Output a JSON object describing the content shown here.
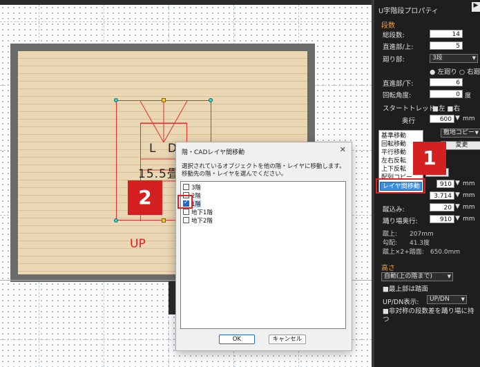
{
  "panel": {
    "title": "U字階段プロパティ",
    "section_steps": "段数",
    "total_steps_label": "総段数:",
    "total_steps_value": "14",
    "straight_upper_label": "直進部/上:",
    "straight_upper_value": "5",
    "turn_label": "廻り部:",
    "turn_value": "3段",
    "turn_dir_left": "左廻り",
    "turn_dir_right": "右廻り",
    "straight_lower_label": "直進部/下:",
    "straight_lower_value": "6",
    "rotation_label": "回転角度:",
    "rotation_value": "0",
    "rotation_unit": "度",
    "start_tread_label": "スタートトレッド",
    "start_left": "左",
    "start_right": "右",
    "depth_label": "奥行",
    "depth_value": "600",
    "depth_unit": "mm",
    "right_drop_label": "敷地コピー",
    "change_label": "変更",
    "width_value": "910",
    "width_unit": "mm",
    "rise_value": "3.714",
    "rise_unit": "mm",
    "nosing_label": "蹴込み:",
    "nosing_value": "20",
    "nosing_unit": "mm",
    "landing_label": "踊り場奥行:",
    "landing_value": "910",
    "landing_unit": "mm",
    "rise_ro": "蹴上:　　207mm",
    "slope_ro": "勾配:　　41.3度",
    "calc_ro": "蹴上×2+踏面:　650.0mm",
    "section_height": "高さ",
    "height_mode": "自動(上の階まで)",
    "top_floor_label": "最上部は踏面",
    "updn_label": "UP/DN表示:",
    "updn_value": "UP/DN",
    "nonsym_label": "非対称の段数差を踊り場に持つ"
  },
  "context_menu": {
    "items": [
      "基準移動",
      "回転移動",
      "平行移動",
      "左右反転",
      "上下反転",
      "配列コピー",
      "レイヤ間移動"
    ],
    "highlighted": "レイヤ間移動"
  },
  "badges": {
    "one": "1",
    "two": "2"
  },
  "canvas": {
    "room_name": "L D",
    "room_size": "15.5畳",
    "up_label": "UP"
  },
  "dialog": {
    "title": "階・CADレイヤ間移動",
    "close": "✕",
    "message_line1": "選択されているオブジェクトを他の階・レイヤに移動します。",
    "message_line2": "移動先の階・レイヤを選んでください。",
    "items": [
      {
        "label": "3階",
        "checked": false
      },
      {
        "label": "2階",
        "checked": false
      },
      {
        "label": "1階",
        "checked": true
      },
      {
        "label": "地下1階",
        "checked": false
      },
      {
        "label": "地下2階",
        "checked": false
      }
    ],
    "ok_label": "OK",
    "cancel_label": "キャンセル"
  },
  "colors": {
    "accent": "#e02020",
    "panel_bg": "#1e1e1e",
    "section": "#f0a040",
    "highlight": "#3a8fe0"
  }
}
